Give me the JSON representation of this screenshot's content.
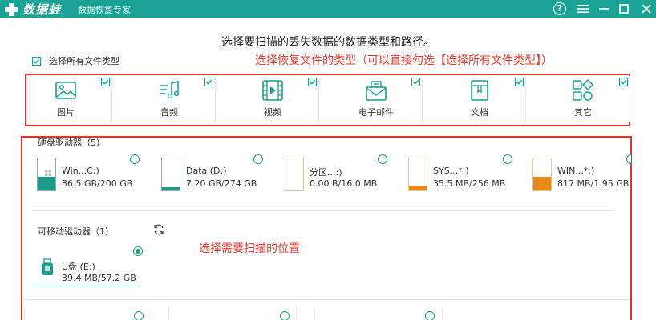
{
  "app": {
    "logo_text": "数据蛙",
    "subtitle": "数据恢复专家",
    "brand_color": "#1aa394"
  },
  "window_controls": [
    {
      "name": "help-icon",
      "glyph": "?"
    },
    {
      "name": "menu-icon",
      "glyph": "≡"
    },
    {
      "name": "minimize-icon",
      "glyph": "—"
    },
    {
      "name": "maximize-icon",
      "glyph": "☐"
    },
    {
      "name": "close-icon",
      "glyph": "✕"
    }
  ],
  "instruction": "选择要扫描的丢失数据的数据类型和路径。",
  "select_all": {
    "label": "选择所有文件类型",
    "checked": true
  },
  "annotations": {
    "type_note": "选择恢复文件的类型（可以直接勾选【选择所有文件类型】）",
    "location_note": "选择需要扫描的位置",
    "color": "#e53a2f"
  },
  "file_types": [
    {
      "label": "图片",
      "icon": "image-icon",
      "checked": true
    },
    {
      "label": "音频",
      "icon": "music-icon",
      "checked": true
    },
    {
      "label": "视频",
      "icon": "film-icon",
      "checked": true
    },
    {
      "label": "电子邮件",
      "icon": "mail-icon",
      "checked": true
    },
    {
      "label": "文档",
      "icon": "document-icon",
      "checked": true
    },
    {
      "label": "其它",
      "icon": "grid-shapes-icon",
      "checked": true
    }
  ],
  "hard_drives": {
    "label": "硬盘驱动器（5）",
    "items": [
      {
        "name": "Win...C:)",
        "size": "86.5 GB/200 GB",
        "used_fraction": 0.43,
        "fill_color": "#1b9a8c",
        "system": true,
        "selected": false
      },
      {
        "name": "Data (D:)",
        "size": "7.20 GB/274 GB",
        "used_fraction": 0.03,
        "fill_color": "#1b9a8c",
        "system": false,
        "selected": false
      },
      {
        "name": "分区...:)",
        "size": "0.00  B/16.0 MB",
        "used_fraction": 0.0,
        "fill_color": "#e88a1a",
        "system": false,
        "selected": false
      },
      {
        "name": "SYS...*:)",
        "size": "35.5 MB/256 MB",
        "used_fraction": 0.14,
        "fill_color": "#e88a1a",
        "system": false,
        "selected": false
      },
      {
        "name": "WIN...*:)",
        "size": "817 MB/1.95 GB",
        "used_fraction": 0.42,
        "fill_color": "#e88a1a",
        "system": false,
        "selected": false
      }
    ]
  },
  "removable_drives": {
    "label": "可移动驱动器（1）",
    "refresh_icon": "refresh-icon",
    "items": [
      {
        "name": "U盘 (E:)",
        "size": "39.4 MB/57.2 GB",
        "selected": true
      }
    ]
  }
}
